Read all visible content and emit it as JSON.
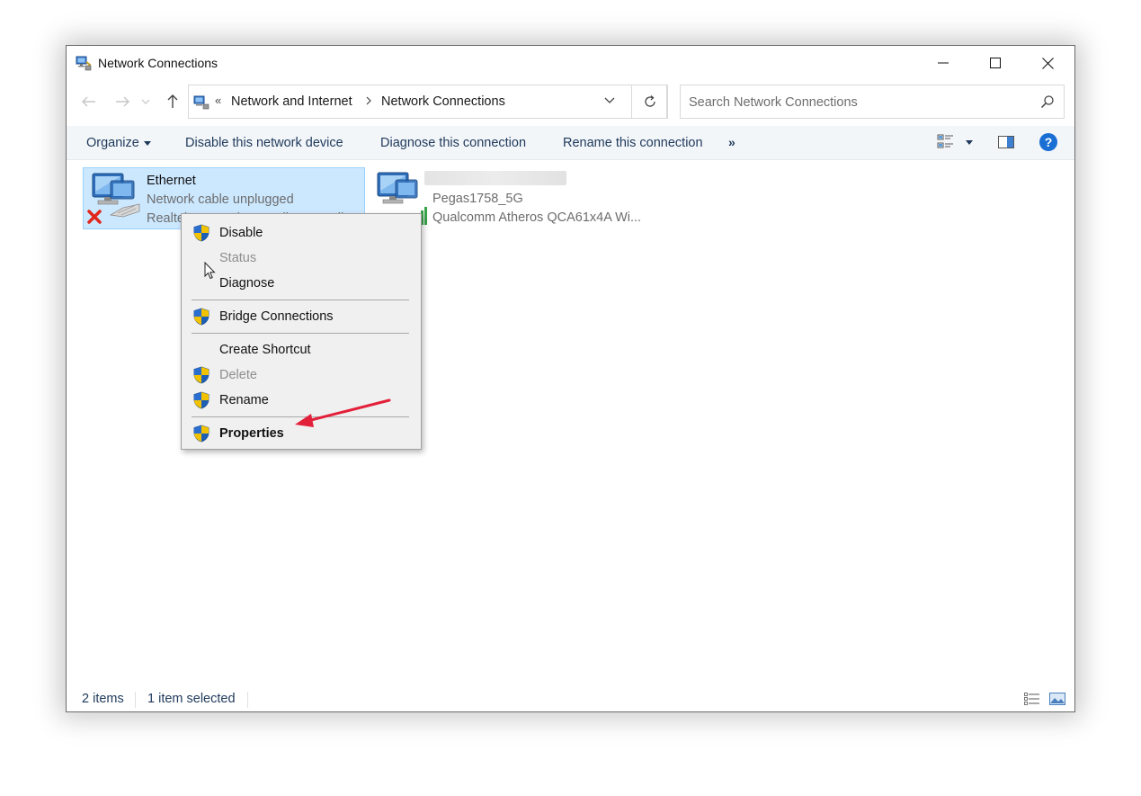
{
  "window": {
    "title": "Network Connections",
    "icon": "network-connections-icon"
  },
  "address": {
    "overflow": "«",
    "crumbs": [
      "Network and Internet",
      "Network Connections"
    ]
  },
  "search": {
    "placeholder": "Search Network Connections"
  },
  "toolbar": {
    "organize": "Organize",
    "disable": "Disable this network device",
    "diagnose": "Diagnose this connection",
    "rename": "Rename this connection",
    "more": "»"
  },
  "items": [
    {
      "name": "Ethernet",
      "status": "Network cable unplugged",
      "device": "Realtek PCIe GbE Family Controller",
      "selected": true,
      "icon": "ethernet-adapter-icon"
    },
    {
      "name": "",
      "status": "Pegas1758_5G",
      "device": "Qualcomm Atheros QCA61x4A Wi...",
      "selected": false,
      "icon": "wifi-adapter-icon"
    }
  ],
  "context_menu": {
    "items": [
      {
        "label": "Disable",
        "shield": true,
        "disabled": false,
        "bold": false
      },
      {
        "label": "Status",
        "shield": false,
        "disabled": true,
        "bold": false
      },
      {
        "label": "Diagnose",
        "shield": false,
        "disabled": false,
        "bold": false
      },
      {
        "label": "Bridge Connections",
        "shield": true,
        "disabled": false,
        "bold": false
      },
      {
        "label": "Create Shortcut",
        "shield": false,
        "disabled": false,
        "bold": false
      },
      {
        "label": "Delete",
        "shield": true,
        "disabled": true,
        "bold": false
      },
      {
        "label": "Rename",
        "shield": true,
        "disabled": false,
        "bold": false
      },
      {
        "label": "Properties",
        "shield": true,
        "disabled": false,
        "bold": true
      }
    ]
  },
  "statusbar": {
    "count": "2 items",
    "selection": "1 item selected"
  },
  "colors": {
    "selection_bg": "#cce8ff",
    "selection_border": "#99d1ff",
    "command_text": "#1e395b",
    "annotation_arrow": "#e3203a",
    "help_blue": "#1a6fd4"
  }
}
